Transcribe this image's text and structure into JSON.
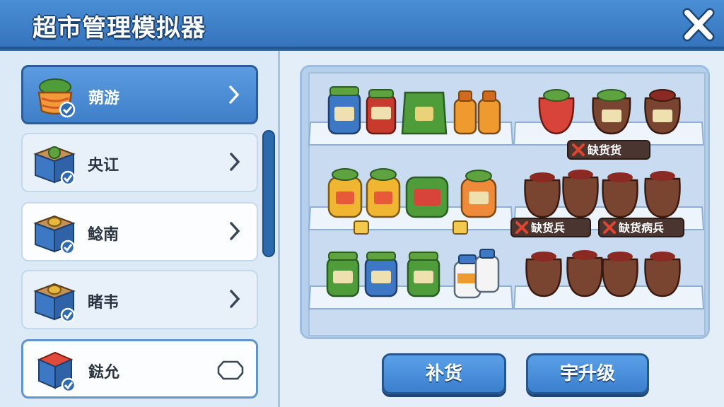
{
  "header": {
    "title": "超市管理模拟器"
  },
  "sidebar": {
    "items": [
      {
        "label": "蒴游",
        "state": "selected"
      },
      {
        "label": "央讧",
        "state": "normal"
      },
      {
        "label": "鲶南",
        "state": "white"
      },
      {
        "label": "睹韦",
        "state": "normal"
      },
      {
        "label": "鍅允",
        "state": "outlined"
      }
    ]
  },
  "shelves": {
    "tags": [
      "缺货货",
      "缺货兵",
      "缺货病兵"
    ]
  },
  "buttons": {
    "restock": "补货",
    "upgrade": "宇升级"
  },
  "colors": {
    "accent": "#3f7fc9",
    "warning": "#e0452f"
  }
}
